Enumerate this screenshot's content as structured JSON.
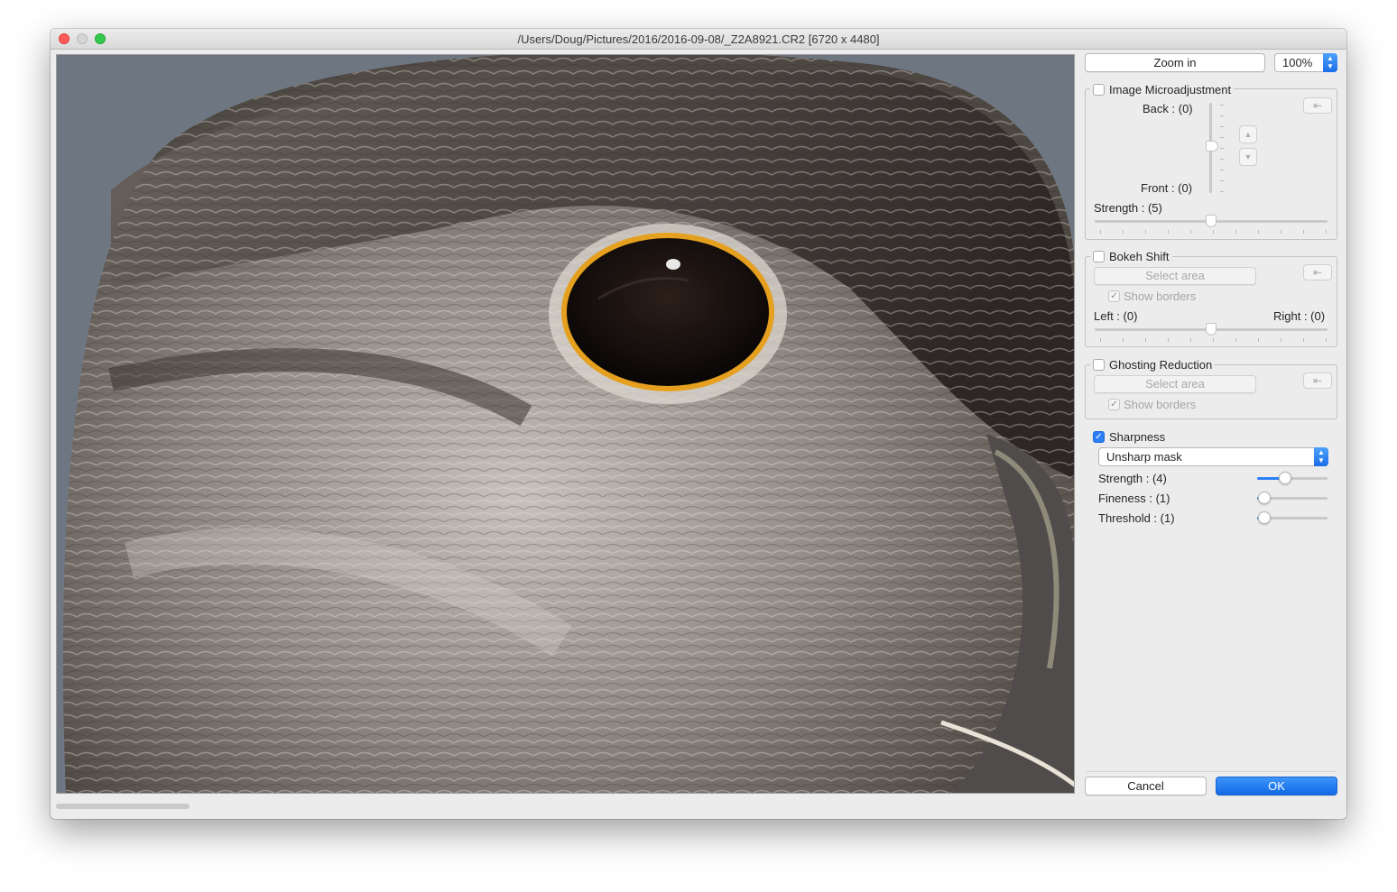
{
  "window": {
    "title": "/Users/Doug/Pictures/2016/2016-09-08/_Z2A8921.CR2 [6720 x 4480]"
  },
  "toolbar": {
    "zoom_button": "Zoom in",
    "zoom_level": "100%"
  },
  "microadjust": {
    "label": "Image Microadjustment",
    "checked": false,
    "back_label": "Back : (0)",
    "front_label": "Front : (0)",
    "strength_label": "Strength : (5)",
    "strength_value": 5
  },
  "bokeh": {
    "label": "Bokeh Shift",
    "checked": false,
    "select_area": "Select area",
    "show_borders": "Show borders",
    "left_label": "Left : (0)",
    "right_label": "Right : (0)"
  },
  "ghosting": {
    "label": "Ghosting Reduction",
    "checked": false,
    "select_area": "Select area",
    "show_borders": "Show borders"
  },
  "sharpness": {
    "label": "Sharpness",
    "checked": true,
    "mode": "Unsharp mask",
    "strength_label": "Strength : (4)",
    "strength_value": 4,
    "fineness_label": "Fineness : (1)",
    "fineness_value": 1,
    "threshold_label": "Threshold : (1)",
    "threshold_value": 1
  },
  "footer": {
    "cancel": "Cancel",
    "ok": "OK"
  },
  "icons": {
    "reset": "reset-arrow-icon",
    "check": "checkmark-icon",
    "up": "chevron-up-icon",
    "down": "chevron-down-icon"
  },
  "colors": {
    "accent": "#2d7ff6",
    "eye_ring": "#e6a11c"
  }
}
